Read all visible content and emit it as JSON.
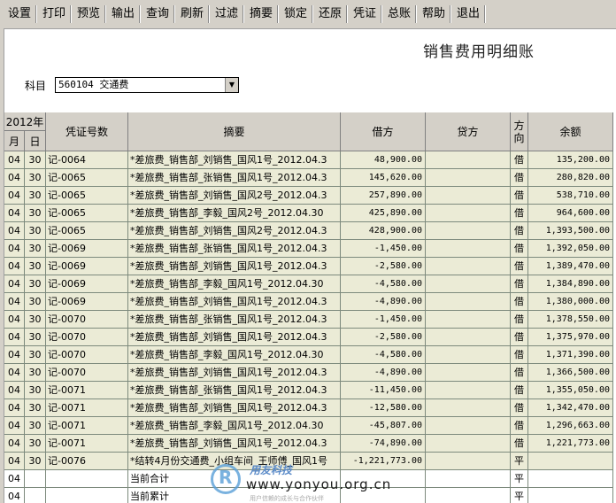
{
  "toolbar": {
    "items": [
      "设置",
      "打印",
      "预览",
      "输出",
      "查询",
      "刷新",
      "过滤",
      "摘要",
      "锁定",
      "还原",
      "凭证",
      "总账",
      "帮助",
      "退出"
    ]
  },
  "title": "销售费用明细账",
  "subject": {
    "label": "科目",
    "value": "560104 交通费"
  },
  "headers": {
    "year": "2012年",
    "month": "月",
    "day": "日",
    "voucher": "凭证号数",
    "summary": "摘要",
    "debit": "借方",
    "credit": "贷方",
    "direction": "方向",
    "balance": "余额"
  },
  "rows": [
    {
      "m": "04",
      "d": "30",
      "v": "记-0064",
      "s": "*差旅费_销售部_刘销售_国风1号_2012.04.3",
      "debit": "48,900.00",
      "credit": "",
      "dir": "借",
      "bal": "135,200.00"
    },
    {
      "m": "04",
      "d": "30",
      "v": "记-0065",
      "s": "*差旅费_销售部_张销售_国风1号_2012.04.3",
      "debit": "145,620.00",
      "credit": "",
      "dir": "借",
      "bal": "280,820.00"
    },
    {
      "m": "04",
      "d": "30",
      "v": "记-0065",
      "s": "*差旅费_销售部_刘销售_国风2号_2012.04.3",
      "debit": "257,890.00",
      "credit": "",
      "dir": "借",
      "bal": "538,710.00"
    },
    {
      "m": "04",
      "d": "30",
      "v": "记-0065",
      "s": "*差旅费_销售部_李毅_国风2号_2012.04.30",
      "debit": "425,890.00",
      "credit": "",
      "dir": "借",
      "bal": "964,600.00"
    },
    {
      "m": "04",
      "d": "30",
      "v": "记-0065",
      "s": "*差旅费_销售部_刘销售_国风2号_2012.04.3",
      "debit": "428,900.00",
      "credit": "",
      "dir": "借",
      "bal": "1,393,500.00"
    },
    {
      "m": "04",
      "d": "30",
      "v": "记-0069",
      "s": "*差旅费_销售部_张销售_国风1号_2012.04.3",
      "debit": "-1,450.00",
      "credit": "",
      "dir": "借",
      "bal": "1,392,050.00"
    },
    {
      "m": "04",
      "d": "30",
      "v": "记-0069",
      "s": "*差旅费_销售部_刘销售_国风1号_2012.04.3",
      "debit": "-2,580.00",
      "credit": "",
      "dir": "借",
      "bal": "1,389,470.00"
    },
    {
      "m": "04",
      "d": "30",
      "v": "记-0069",
      "s": "*差旅费_销售部_李毅_国风1号_2012.04.30",
      "debit": "-4,580.00",
      "credit": "",
      "dir": "借",
      "bal": "1,384,890.00"
    },
    {
      "m": "04",
      "d": "30",
      "v": "记-0069",
      "s": "*差旅费_销售部_刘销售_国风1号_2012.04.3",
      "debit": "-4,890.00",
      "credit": "",
      "dir": "借",
      "bal": "1,380,000.00"
    },
    {
      "m": "04",
      "d": "30",
      "v": "记-0070",
      "s": "*差旅费_销售部_张销售_国风1号_2012.04.3",
      "debit": "-1,450.00",
      "credit": "",
      "dir": "借",
      "bal": "1,378,550.00"
    },
    {
      "m": "04",
      "d": "30",
      "v": "记-0070",
      "s": "*差旅费_销售部_刘销售_国风1号_2012.04.3",
      "debit": "-2,580.00",
      "credit": "",
      "dir": "借",
      "bal": "1,375,970.00"
    },
    {
      "m": "04",
      "d": "30",
      "v": "记-0070",
      "s": "*差旅费_销售部_李毅_国风1号_2012.04.30",
      "debit": "-4,580.00",
      "credit": "",
      "dir": "借",
      "bal": "1,371,390.00"
    },
    {
      "m": "04",
      "d": "30",
      "v": "记-0070",
      "s": "*差旅费_销售部_刘销售_国风1号_2012.04.3",
      "debit": "-4,890.00",
      "credit": "",
      "dir": "借",
      "bal": "1,366,500.00"
    },
    {
      "m": "04",
      "d": "30",
      "v": "记-0071",
      "s": "*差旅费_销售部_张销售_国风1号_2012.04.3",
      "debit": "-11,450.00",
      "credit": "",
      "dir": "借",
      "bal": "1,355,050.00"
    },
    {
      "m": "04",
      "d": "30",
      "v": "记-0071",
      "s": "*差旅费_销售部_刘销售_国风1号_2012.04.3",
      "debit": "-12,580.00",
      "credit": "",
      "dir": "借",
      "bal": "1,342,470.00"
    },
    {
      "m": "04",
      "d": "30",
      "v": "记-0071",
      "s": "*差旅费_销售部_李毅_国风1号_2012.04.30",
      "debit": "-45,807.00",
      "credit": "",
      "dir": "借",
      "bal": "1,296,663.00"
    },
    {
      "m": "04",
      "d": "30",
      "v": "记-0071",
      "s": "*差旅费_销售部_刘销售_国风1号_2012.04.3",
      "debit": "-74,890.00",
      "credit": "",
      "dir": "借",
      "bal": "1,221,773.00"
    },
    {
      "m": "04",
      "d": "30",
      "v": "记-0076",
      "s": "*结转4月份交通费_小组车间_王师傅_国风1号",
      "debit": "-1,221,773.00",
      "credit": "",
      "dir": "平",
      "bal": ""
    },
    {
      "m": "04",
      "d": "",
      "v": "",
      "s": "当前合计",
      "debit": "",
      "credit": "",
      "dir": "平",
      "bal": ""
    },
    {
      "m": "04",
      "d": "",
      "v": "",
      "s": "当前累计",
      "debit": "",
      "credit": "",
      "dir": "平",
      "bal": ""
    }
  ],
  "watermark": {
    "logo_letter": "R",
    "name": "用友科技",
    "url": "www.yonyou.org.cn",
    "slogan": "用户信赖的成长与合作伙伴",
    "color": "#5aa0d8"
  }
}
